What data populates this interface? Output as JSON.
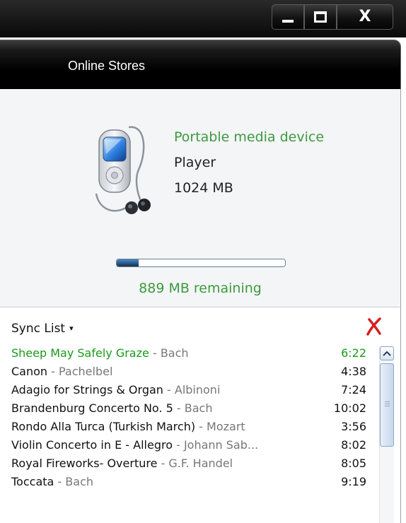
{
  "window": {
    "controls": {
      "minimize_icon": "minimize-icon",
      "maximize_icon": "maximize-icon",
      "close_glyph": "X"
    }
  },
  "tabs": [
    {
      "label": "Online Stores"
    }
  ],
  "device": {
    "icon": "portable-media-player-icon",
    "kind": "Portable media device",
    "name": "Player",
    "capacity": "1024 MB",
    "storage_used_fraction": 0.13,
    "remaining": "889 MB remaining"
  },
  "sync": {
    "menu_label": "Sync List",
    "menu_arrow": "▾",
    "clear_icon": "red-x-icon",
    "tracks": [
      {
        "title": "Sheep May Safely Graze",
        "artist": "Bach",
        "duration": "6:22",
        "playing": true
      },
      {
        "title": "Canon",
        "artist": "Pachelbel",
        "duration": "4:38",
        "playing": false
      },
      {
        "title": "Adagio for Strings & Organ",
        "artist": "Albinoni",
        "duration": "7:24",
        "playing": false
      },
      {
        "title": "Brandenburg Concerto No. 5",
        "artist": "Bach",
        "duration": "10:02",
        "playing": false
      },
      {
        "title": "Rondo Alla Turca (Turkish March)",
        "artist": "Mozart",
        "duration": "3:56",
        "playing": false
      },
      {
        "title": "Violin Concerto in E - Allegro",
        "artist": "Johann Sab...",
        "duration": "8:02",
        "playing": false
      },
      {
        "title": "Royal Fireworks- Overture",
        "artist": "G.F. Handel",
        "duration": "8:05",
        "playing": false
      },
      {
        "title": "Toccata",
        "artist": "Bach",
        "duration": "9:19",
        "playing": false
      }
    ],
    "separator": " - "
  },
  "colors": {
    "accent_green": "#3e9a3e",
    "playing_green": "#1a9a1a",
    "clear_red": "#d42020"
  }
}
